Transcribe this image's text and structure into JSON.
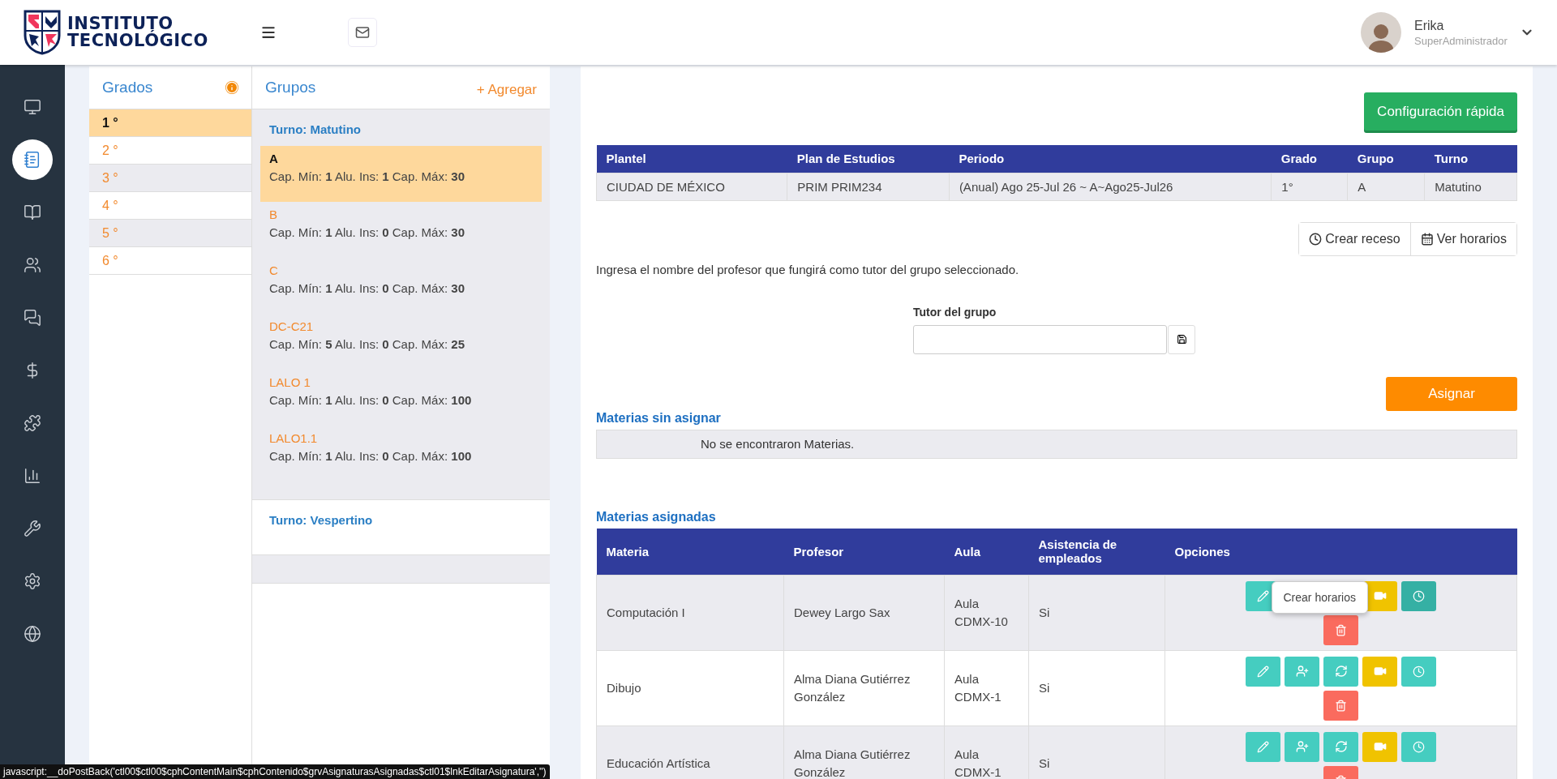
{
  "header": {
    "logo_line1": "INSTITUTO",
    "logo_line2": "TECNOLÓGICO",
    "user": {
      "name": "Erika",
      "role": "SuperAdministrador"
    }
  },
  "sidebar": {
    "items": [
      {
        "kind": "monitor",
        "selected": false
      },
      {
        "kind": "notebook",
        "selected": true
      },
      {
        "kind": "book",
        "selected": false
      },
      {
        "kind": "users",
        "selected": false
      },
      {
        "kind": "chat",
        "selected": false
      },
      {
        "kind": "dollar",
        "selected": false
      },
      {
        "kind": "puzzle",
        "selected": false
      },
      {
        "kind": "chart",
        "selected": false
      },
      {
        "kind": "wrench",
        "selected": false
      },
      {
        "kind": "cogs",
        "selected": false
      },
      {
        "kind": "globe",
        "selected": false
      }
    ]
  },
  "grados": {
    "title": "Grados",
    "items": [
      {
        "label": "1 °",
        "selected": true
      },
      {
        "label": "2 °",
        "selected": false
      },
      {
        "label": "3 °",
        "selected": false
      },
      {
        "label": "4 °",
        "selected": false
      },
      {
        "label": "5 °",
        "selected": false
      },
      {
        "label": "6 °",
        "selected": false
      }
    ]
  },
  "grupos": {
    "title": "Grupos",
    "add_label": "+ Agregar",
    "turnos": [
      {
        "title": "Turno: Matutino",
        "groups": [
          {
            "name": "A",
            "info": "Cap. Mín: **1** Alu. Ins: **1** Cap. Máx: **30**",
            "selected": true
          },
          {
            "name": "B",
            "info": "Cap. Mín: **1** Alu. Ins: **0** Cap. Máx: **30**",
            "selected": false
          },
          {
            "name": "C",
            "info": "Cap. Mín: **1** Alu. Ins: **0** Cap. Máx: **30**",
            "selected": false
          },
          {
            "name": "DC-C21",
            "info": "Cap. Mín: **5** Alu. Ins: **0** Cap. Máx: **25**",
            "selected": false
          },
          {
            "name": "LALO 1",
            "info": "Cap. Mín: **1** Alu. Ins: **0** Cap. Máx: **100**",
            "selected": false
          },
          {
            "name": "LALO1.1",
            "info": "Cap. Mín: **1** Alu. Ins: **0** Cap. Máx: **100**",
            "selected": false
          }
        ]
      },
      {
        "title": "Turno: Vespertino"
      }
    ]
  },
  "quick_config": "Configuración rápida",
  "summary": {
    "columns": [
      "Plantel",
      "Plan de Estudios",
      "Periodo",
      "Grado",
      "Grupo",
      "Turno"
    ],
    "rows": [
      [
        "CIUDAD DE MÉXICO",
        "PRIM PRIM234",
        "(Anual) Ago 25-Jul 26 ~ A~Ago25-Jul26",
        "1°",
        "A",
        "Matutino"
      ]
    ]
  },
  "tools": [
    {
      "kind": "clock",
      "label": "Crear receso"
    },
    {
      "kind": "calendar",
      "label": "Ver horarios"
    }
  ],
  "tutor": {
    "instruction": "Ingresa el nombre del profesor que fungirá como tutor del grupo seleccionado.",
    "label": "Tutor del grupo"
  },
  "assign_button": "Asignar",
  "unassigned": {
    "title": "Materias sin asignar",
    "empty_text": "No se encontraron Materias."
  },
  "assigned": {
    "title": "Materias asignadas",
    "columns": [
      "Materia",
      "Profesor",
      "Aula",
      "Asistencia de empleados",
      "Opciones"
    ],
    "rows": [
      {
        "cells": [
          "Computación I",
          "Dewey Largo Sax",
          "Aula CDMX-10",
          "Si"
        ],
        "tooltip": "Crear horarios"
      },
      {
        "cells": [
          "Dibujo",
          "Alma Diana Gutiérrez González",
          "Aula CDMX-1",
          "Si"
        ]
      },
      {
        "cells": [
          "Educación Artística",
          "Alma Diana Gutiérrez González",
          "Aula CDMX-1",
          "Si"
        ]
      }
    ]
  },
  "status_bar": "javascript:__doPostBack('ctl00$ctl00$cphContentMain$cphContenido$grvAsignaturasAsignadas$ctl01$lnkEditarAsignatura','')"
}
